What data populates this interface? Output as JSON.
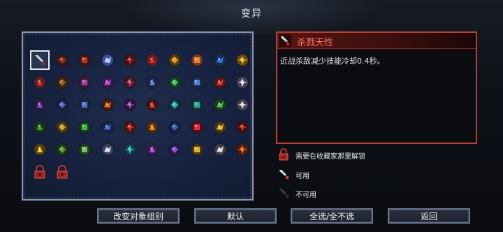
{
  "screen": {
    "title": "变异"
  },
  "grid": {
    "cells": [
      {
        "icon": "dagger-selected-icon",
        "color": "#d8dde8",
        "accent": "#8a3030",
        "selected": true
      },
      {
        "icon": "crossbow-icon",
        "color": "#a03028",
        "accent": "#3a1a18"
      },
      {
        "icon": "red-cross-icon",
        "color": "#c0302a",
        "accent": "#3a1a18"
      },
      {
        "icon": "wing-blade-icon",
        "color": "#c8d0e0",
        "accent": "#3050a0"
      },
      {
        "icon": "red-slash-icon",
        "color": "#c02828",
        "accent": "#401414"
      },
      {
        "icon": "red-skull-icon",
        "color": "#d83030",
        "accent": "#6a2020"
      },
      {
        "icon": "gold-chest-icon",
        "color": "#e0a020",
        "accent": "#5a3a10"
      },
      {
        "icon": "gold-gear-icon",
        "color": "#e08a30",
        "accent": "#7a3a20"
      },
      {
        "icon": "blue-potion-icon",
        "color": "#3878e0",
        "accent": "#1a2a5a"
      },
      {
        "icon": "lightning-icon",
        "color": "#f0c030",
        "accent": "#6a4a10"
      },
      {
        "icon": "red-mushroom-icon",
        "color": "#d03838",
        "accent": "#602020"
      },
      {
        "icon": "brown-boot-icon",
        "color": "#a0602a",
        "accent": "#3a2410"
      },
      {
        "icon": "purple-orb-icon",
        "color": "#a040a0",
        "accent": "#3a1a3a"
      },
      {
        "icon": "violet-rune-icon",
        "color": "#b050d0",
        "accent": "#3a1a50"
      },
      {
        "icon": "pink-blade-icon",
        "color": "#d04870",
        "accent": "#401828"
      },
      {
        "icon": "blue-trident-icon",
        "color": "#6080d0",
        "accent": "#1a2450"
      },
      {
        "icon": "green-flask-icon",
        "color": "#40c070",
        "accent": "#154020"
      },
      {
        "icon": "blue-wings-icon",
        "color": "#5080d0",
        "accent": "#1a2a50"
      },
      {
        "icon": "red-eye-icon",
        "color": "#e04040",
        "accent": "#501818"
      },
      {
        "icon": "white-snake-icon",
        "color": "#e8e8f0",
        "accent": "#404058"
      },
      {
        "icon": "purple-arrow-icon",
        "color": "#9050c0",
        "accent": "#2a1a48"
      },
      {
        "icon": "indigo-blocks-icon",
        "color": "#6060c0",
        "accent": "#1a1a48"
      },
      {
        "icon": "blue-sword-icon",
        "color": "#5070c0",
        "accent": "#1a2448"
      },
      {
        "icon": "fire-chest-icon",
        "color": "#e07030",
        "accent": "#402010"
      },
      {
        "icon": "purple-potion-icon",
        "color": "#a050c0",
        "accent": "#2a1440"
      },
      {
        "icon": "red-mask-icon",
        "color": "#d04040",
        "accent": "#401414"
      },
      {
        "icon": "cyan-crest-icon",
        "color": "#40b0c0",
        "accent": "#103840"
      },
      {
        "icon": "teal-shield-icon",
        "color": "#30a0a0",
        "accent": "#103838"
      },
      {
        "icon": "green-skull-icon",
        "color": "#50c050",
        "accent": "#184018"
      },
      {
        "icon": "white-cow-icon",
        "color": "#e0e0e8",
        "accent": "#404050"
      },
      {
        "icon": "green-tree-icon",
        "color": "#40a040",
        "accent": "#163816"
      },
      {
        "icon": "gold-sword-icon",
        "color": "#d0a030",
        "accent": "#4a3810"
      },
      {
        "icon": "green-orb-icon",
        "color": "#40b050",
        "accent": "#154018"
      },
      {
        "icon": "blue-castle-icon",
        "color": "#4070d0",
        "accent": "#142450"
      },
      {
        "icon": "red-heart-icon",
        "color": "#e03838",
        "accent": "#501414"
      },
      {
        "icon": "orange-arrows-icon",
        "color": "#f08a20",
        "accent": "#503010"
      },
      {
        "icon": "blue-book-icon",
        "color": "#4060c0",
        "accent": "#142048"
      },
      {
        "icon": "red-gem-icon",
        "color": "#e03040",
        "accent": "#501018"
      },
      {
        "icon": "yellow-claw-icon",
        "color": "#e0c030",
        "accent": "#4a3a10"
      },
      {
        "icon": "red-ring-icon",
        "color": "#d03030",
        "accent": "#401010"
      },
      {
        "icon": "yellow-chevrons-icon",
        "color": "#f0d030",
        "accent": "#504010"
      },
      {
        "icon": "green-bottle-icon",
        "color": "#60a040",
        "accent": "#1e3814"
      },
      {
        "icon": "green-face-icon",
        "color": "#70c070",
        "accent": "#1e401e"
      },
      {
        "icon": "white-face-icon",
        "color": "#d8e0f0",
        "accent": "#384058"
      },
      {
        "icon": "cyan-castle-icon",
        "color": "#40c0d0",
        "accent": "#104048"
      },
      {
        "icon": "purple-ghost-icon",
        "color": "#b050e0",
        "accent": "#381a50"
      },
      {
        "icon": "purple-fire-icon",
        "color": "#9050d0",
        "accent": "#2a1a48"
      },
      {
        "icon": "gold-coins-icon",
        "color": "#e0b030",
        "accent": "#4a3810"
      },
      {
        "icon": "white-dog-icon",
        "color": "#e0e0e0",
        "accent": "#404048"
      },
      {
        "icon": "orange-flame-icon",
        "color": "#f07020",
        "accent": "#502010"
      },
      {
        "icon": "red-lock-icon",
        "color": "#c03030",
        "accent": "#401010",
        "locked": true
      },
      {
        "icon": "red-lock-icon",
        "color": "#c03030",
        "accent": "#401010",
        "locked": true
      }
    ]
  },
  "detail": {
    "title": "杀戮天性",
    "description": "近战杀敌减少技能冷却0.4秒。",
    "icon": "dagger-icon"
  },
  "legend": {
    "locked_label": "需要在收藏家那里解锁",
    "available_label": "可用",
    "unavailable_label": "不可用"
  },
  "buttons": {
    "change_group": "改变对象组别",
    "default": "默认",
    "select_all": "全选/全不选",
    "back": "返回"
  },
  "colors": {
    "accent_red": "#b3403c",
    "title_red": "#ff7a66",
    "panel_blue": "#172240"
  }
}
